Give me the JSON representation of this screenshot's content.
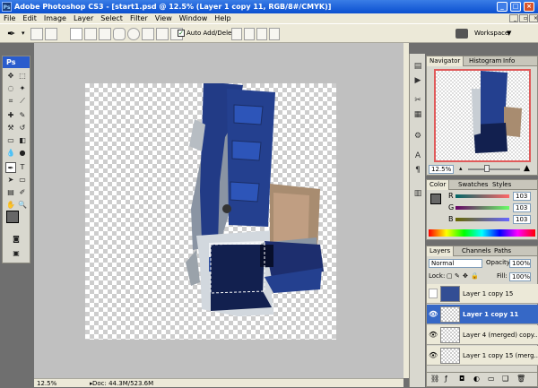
{
  "window": {
    "title": "Adobe Photoshop CS3 - [start1.psd @ 12.5% (Layer 1 copy 11, RGB/8#/CMYK)]",
    "app_badge": "Ps"
  },
  "menu": [
    "File",
    "Edit",
    "Image",
    "Layer",
    "Select",
    "Filter",
    "View",
    "Window",
    "Help"
  ],
  "options": {
    "auto_add_delete": "Auto Add/Delete",
    "workspace": "Workspace"
  },
  "toolbox": {
    "badge": "Ps"
  },
  "status": {
    "zoom": "12.5%",
    "doc": "Doc: 44.3M/523.6M"
  },
  "navigator": {
    "tabs": [
      "Navigator",
      "Histogram",
      "Info"
    ],
    "zoom": "12.5%"
  },
  "color": {
    "tabs": [
      "Color",
      "Swatches",
      "Styles"
    ],
    "channels": [
      {
        "label": "R",
        "value": "103"
      },
      {
        "label": "G",
        "value": "103"
      },
      {
        "label": "B",
        "value": "103"
      }
    ]
  },
  "layers": {
    "tabs": [
      "Layers",
      "Channels",
      "Paths"
    ],
    "blend_mode": "Normal",
    "opacity_label": "Opacity:",
    "opacity": "100%",
    "lock_label": "Lock:",
    "fill_label": "Fill:",
    "fill": "100%",
    "items": [
      {
        "name": "Layer 1 copy 15",
        "visible": false,
        "selected": false
      },
      {
        "name": "Layer 1 copy 11",
        "visible": true,
        "selected": true
      },
      {
        "name": "Layer 4 (merged) copy...",
        "visible": true,
        "selected": false
      },
      {
        "name": "Layer 1 copy 15 (merg...",
        "visible": true,
        "selected": false
      }
    ]
  },
  "colors": {
    "accent": "#3668c6",
    "titlebar": "#0a4fd0",
    "foreground": "#676767"
  }
}
